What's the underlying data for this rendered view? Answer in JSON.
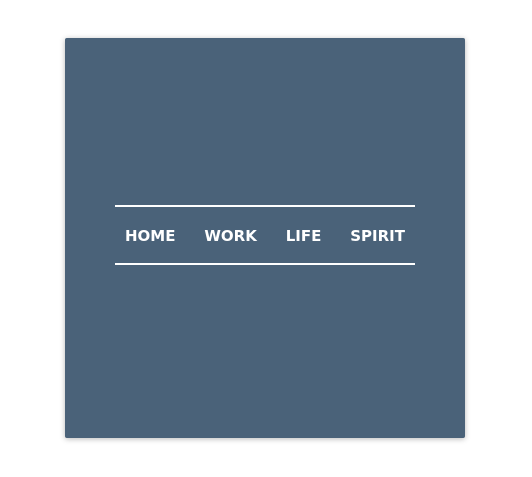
{
  "colors": {
    "card_background": "#4a6279",
    "text": "#ffffff",
    "rule": "#ffffff"
  },
  "nav": {
    "items": [
      {
        "label": "HOME"
      },
      {
        "label": "WORK"
      },
      {
        "label": "LIFE"
      },
      {
        "label": "SPIRIT"
      }
    ]
  }
}
